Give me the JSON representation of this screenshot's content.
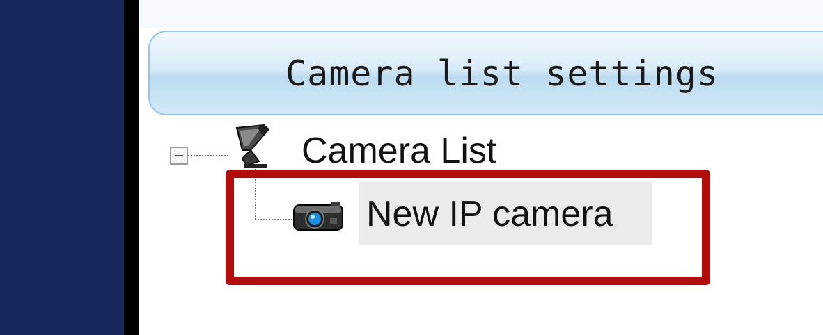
{
  "header": {
    "title": "Camera list settings"
  },
  "tree": {
    "root": {
      "label": "Camera List",
      "expander": "−",
      "icon": "camera-list-icon"
    },
    "items": [
      {
        "label": "New IP camera",
        "icon": "ip-camera-icon",
        "selected": true
      }
    ]
  },
  "colors": {
    "sidebar": "#17275c",
    "header_border": "#8fc6ee",
    "highlight_box": "#b10d0d",
    "selected_item_bg": "#ebebeb"
  }
}
